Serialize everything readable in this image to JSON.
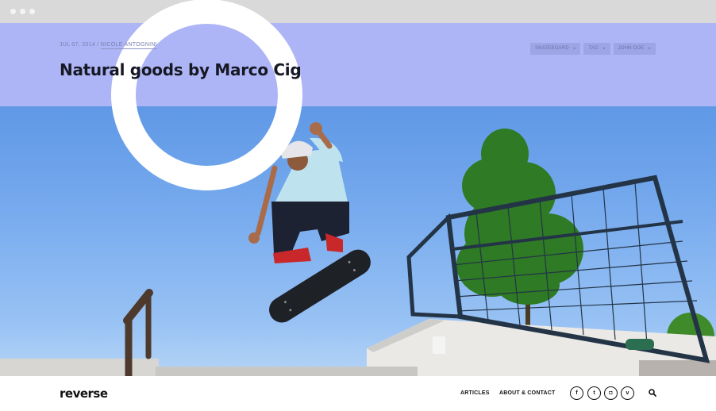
{
  "post": {
    "date": "JUL 07, 2014",
    "separator": "/",
    "author": "NICOLE ANTOGNINI",
    "title": "Natural goods by Marco Cig"
  },
  "tags": [
    {
      "label": "SKATEBOARD",
      "arrow": "▸"
    },
    {
      "label": "TAG",
      "arrow": "▸"
    },
    {
      "label": "JOHN DOE",
      "arrow": "▸"
    }
  ],
  "footer": {
    "logo": "reverse",
    "nav": {
      "articles": "ARTICLES",
      "about": "ABOUT & CONTACT"
    },
    "social": {
      "facebook": "f",
      "twitter": "t",
      "instagram": "◘",
      "vimeo": "v"
    }
  },
  "colors": {
    "header_band": "#aeb5f6",
    "sky": "#78abee",
    "ring": "#ffffff"
  },
  "icons": [
    "facebook-icon",
    "twitter-icon",
    "instagram-icon",
    "vimeo-icon",
    "search-icon"
  ]
}
